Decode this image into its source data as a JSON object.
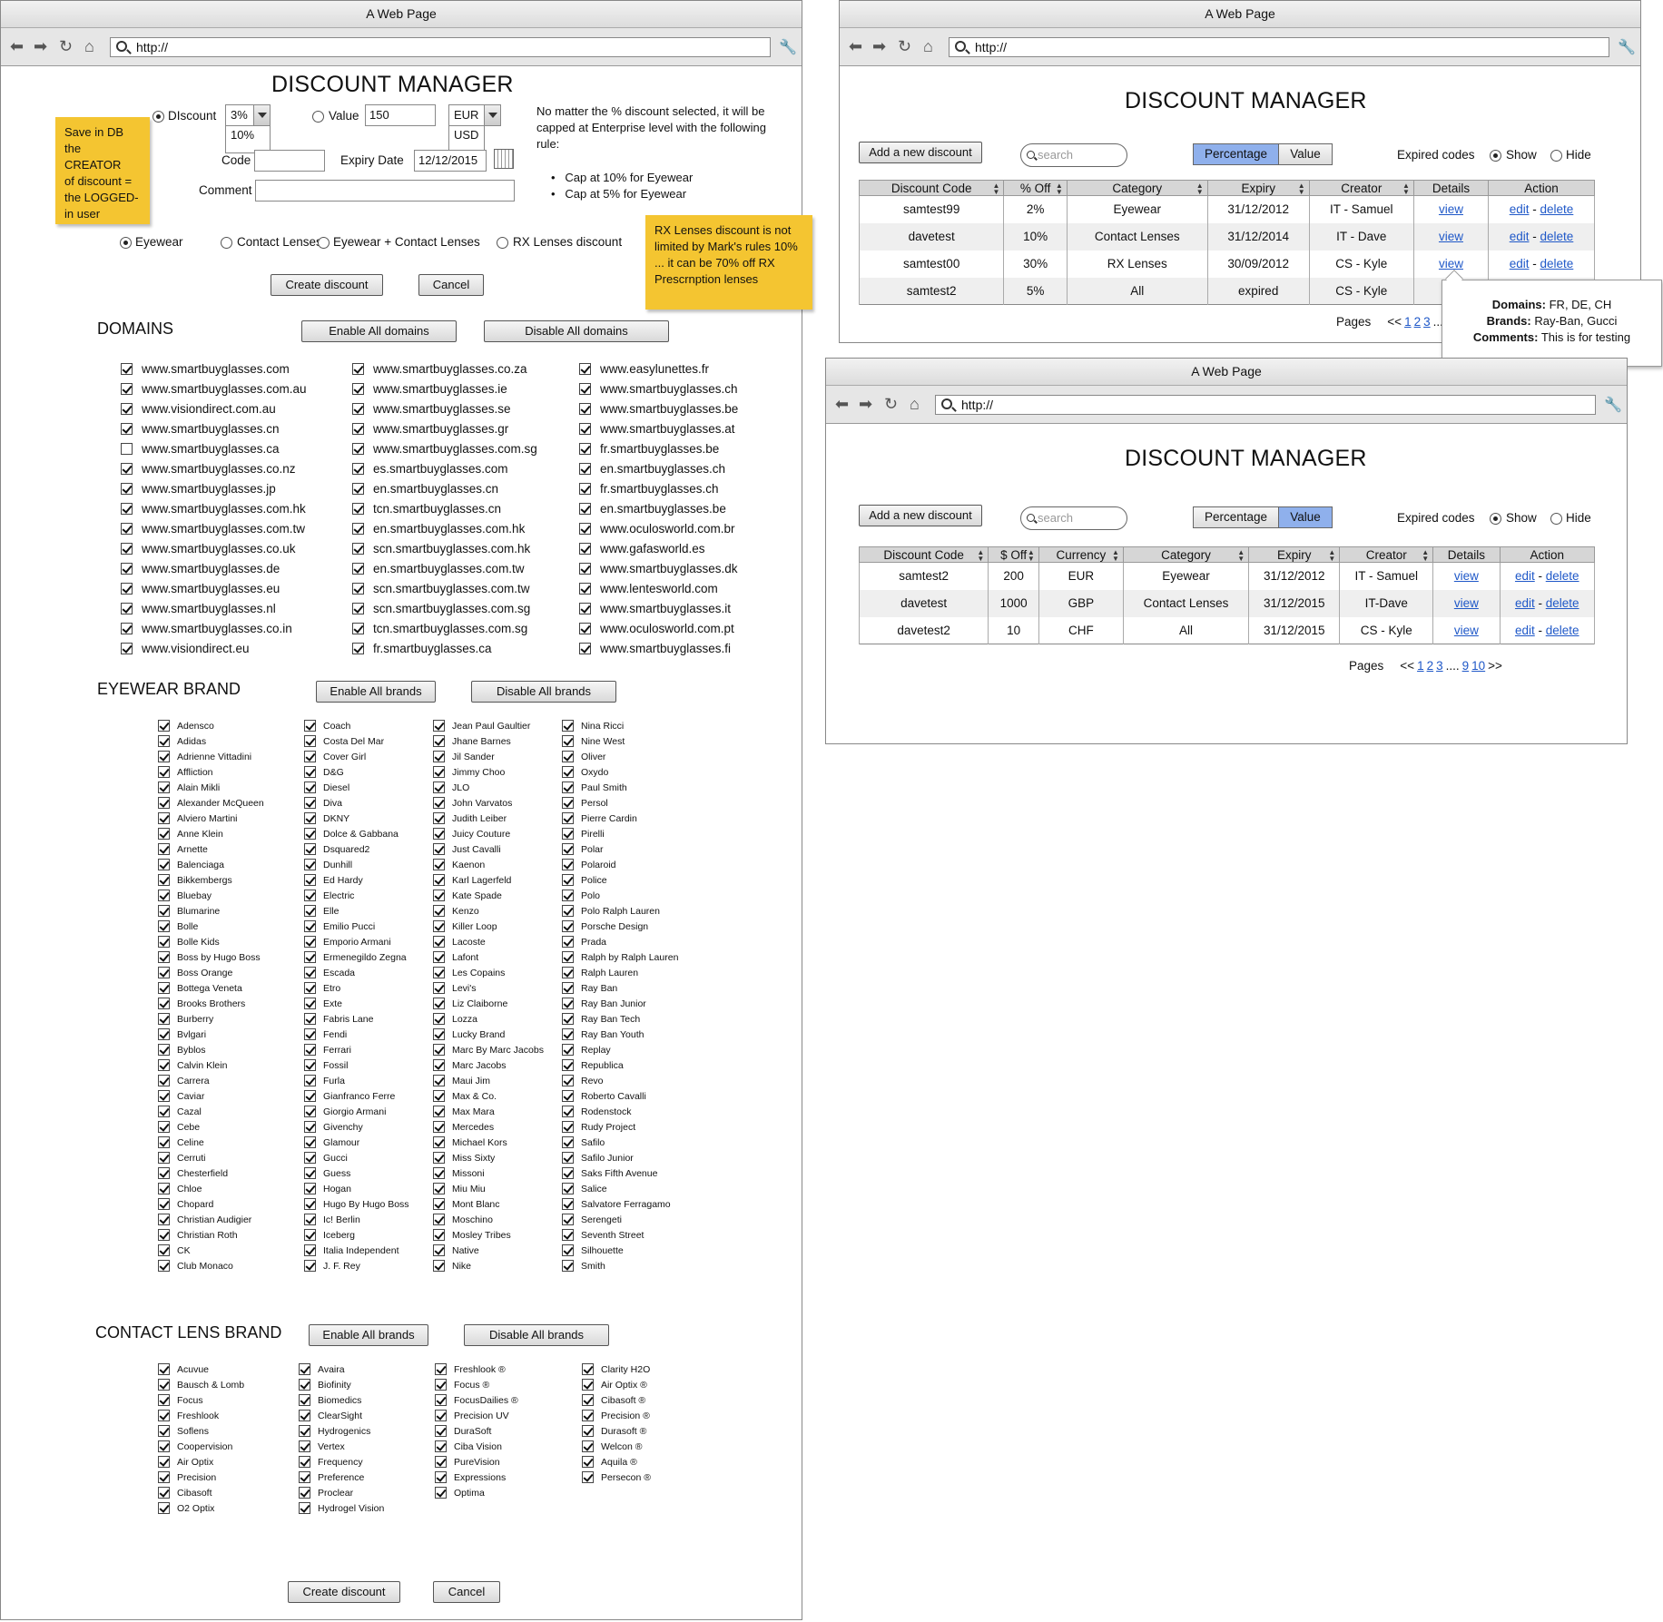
{
  "window_title": "A Web Page",
  "url": "http://",
  "app_title": "DISCOUNT MANAGER",
  "form": {
    "discount_label": "DIscount",
    "discount_selected": "3%",
    "discount_options": [
      "10%"
    ],
    "value_label": "Value",
    "value_input": "150",
    "currency_selected": "EUR",
    "currency_options": [
      "USD"
    ],
    "code_label": "Code",
    "code_value": "",
    "expiry_label": "Expiry Date",
    "expiry_value": "12/12/2015",
    "comment_label": "Comment",
    "comment_value": "",
    "note_line1": "No matter the % discount selected, it will be",
    "note_line2": "capped at Enterprise level with the following",
    "note_line3": "rule:",
    "rules": [
      "Cap at 10% for Eyewear",
      "Cap at 5% for Eyewear"
    ],
    "sticky_db": [
      "Save in DB",
      "the CREATOR",
      "of discount =",
      "the LOGGED-",
      "in user"
    ],
    "sticky_rx": [
      "RX Lenses discount is not",
      "limited by Mark's rules 10%",
      "... it can be 70% off RX",
      "Prescrnption lenses"
    ],
    "categories": [
      "Eyewear",
      "Contact Lenses",
      "Eyewear + Contact Lenses",
      "RX Lenses discount"
    ],
    "create_label": "Create discount",
    "cancel_label": "Cancel"
  },
  "domains": {
    "title": "DOMAINS",
    "enable_label": "Enable All domains",
    "disable_label": "Disable All domains",
    "columns": [
      [
        "www.smartbuyglasses.com",
        "www.smartbuyglasses.com.au",
        "www.visiondirect.com.au",
        "www.smartbuyglasses.cn",
        "www.smartbuyglasses.ca",
        "www.smartbuyglasses.co.nz",
        "www.smartbuyglasses.jp",
        "www.smartbuyglasses.com.hk",
        "www.smartbuyglasses.com.tw",
        "www.smartbuyglasses.co.uk",
        "www.smartbuyglasses.de",
        "www.smartbuyglasses.eu",
        "www.smartbuyglasses.nl",
        "www.smartbuyglasses.co.in",
        "www.visiondirect.eu"
      ],
      [
        "www.smartbuyglasses.co.za",
        "www.smartbuyglasses.ie",
        "www.smartbuyglasses.se",
        "www.smartbuyglasses.gr",
        "www.smartbuyglasses.com.sg",
        "es.smartbuyglasses.com",
        "en.smartbuyglasses.cn",
        "tcn.smartbuyglasses.cn",
        "en.smartbuyglasses.com.hk",
        "scn.smartbuyglasses.com.hk",
        "en.smartbuyglasses.com.tw",
        "scn.smartbuyglasses.com.tw",
        "scn.smartbuyglasses.com.sg",
        "tcn.smartbuyglasses.com.sg",
        "fr.smartbuyglasses.ca"
      ],
      [
        "www.easylunettes.fr",
        "www.smartbuyglasses.ch",
        "www.smartbuyglasses.be",
        "www.smartbuyglasses.at",
        "fr.smartbuyglasses.be",
        "en.smartbuyglasses.ch",
        "fr.smartbuyglasses.ch",
        "en.smartbuyglasses.be",
        "www.oculosworld.com.br",
        "www.gafasworld.es",
        "www.smartbuyglasses.dk",
        "www.lentesworld.com",
        "www.smartbuyglasses.it",
        "www.oculosworld.com.pt",
        "www.smartbuyglasses.fi"
      ]
    ],
    "unchecked": [
      "www.smartbuyglasses.ca"
    ]
  },
  "eyewear": {
    "title": "EYEWEAR BRAND",
    "enable_label": "Enable All brands",
    "disable_label": "Disable All brands",
    "columns": [
      [
        "Adensco",
        "Adidas",
        "Adrienne Vittadini",
        "Affliction",
        "Alain Mikli",
        "Alexander McQueen",
        "Alviero Martini",
        "Anne Klein",
        "Arnette",
        "Balenciaga",
        "Bikkembergs",
        "Bluebay",
        "Blumarine",
        "Bolle",
        "Bolle Kids",
        "Boss by Hugo Boss",
        "Boss Orange",
        "Bottega Veneta",
        "Brooks Brothers",
        "Burberry",
        "Bvlgari",
        "Byblos",
        "Calvin Klein",
        "Carrera",
        "Caviar",
        "Cazal",
        "Cebe",
        "Celine",
        "Cerruti",
        "Chesterfield",
        "Chloe",
        "Chopard",
        "Christian Audigier",
        "Christian Roth",
        "CK",
        "Club Monaco"
      ],
      [
        "Coach",
        "Costa Del Mar",
        "Cover Girl",
        "D&G",
        "Diesel",
        "Diva",
        "DKNY",
        "Dolce & Gabbana",
        "Dsquared2",
        "Dunhill",
        "Ed Hardy",
        "Electric",
        "Elle",
        "Emilio Pucci",
        "Emporio Armani",
        "Ermenegildo Zegna",
        "Escada",
        "Etro",
        "Exte",
        "Fabris Lane",
        "Fendi",
        "Ferrari",
        "Fossil",
        "Furla",
        "Gianfranco Ferre",
        "Giorgio Armani",
        "Givenchy",
        "Glamour",
        "Gucci",
        "Guess",
        "Hogan",
        "Hugo By Hugo Boss",
        "Ic! Berlin",
        "Iceberg",
        "Italia Independent",
        "J. F. Rey"
      ],
      [
        "Jean Paul Gaultier",
        "Jhane Barnes",
        "Jil Sander",
        "Jimmy Choo",
        "JLO",
        "John Varvatos",
        "Judith Leiber",
        "Juicy Couture",
        "Just Cavalli",
        "Kaenon",
        "Karl Lagerfeld",
        "Kate Spade",
        "Kenzo",
        "Killer Loop",
        "Lacoste",
        "Lafont",
        "Les Copains",
        "Levi's",
        "Liz Claiborne",
        "Lozza",
        "Lucky Brand",
        "Marc By Marc Jacobs",
        "Marc Jacobs",
        "Maui Jim",
        "Max & Co.",
        "Max Mara",
        "Mercedes",
        "Michael Kors",
        "Miss Sixty",
        "Missoni",
        "Miu Miu",
        "Mont Blanc",
        "Moschino",
        "Mosley Tribes",
        "Native",
        "Nike"
      ],
      [
        "Nina Ricci",
        "Nine West",
        "Oliver",
        "Oxydo",
        "Paul Smith",
        "Persol",
        "Pierre Cardin",
        "Pirelli",
        "Polar",
        "Polaroid",
        "Police",
        "Polo",
        "Polo Ralph Lauren",
        "Porsche Design",
        "Prada",
        "Ralph by Ralph Lauren",
        "Ralph Lauren",
        "Ray Ban",
        "Ray Ban Junior",
        "Ray Ban Tech",
        "Ray Ban Youth",
        "Replay",
        "Republica",
        "Revo",
        "Roberto Cavalli",
        "Rodenstock",
        "Rudy Project",
        "Safilo",
        "Safilo Junior",
        "Saks Fifth Avenue",
        "Salice",
        "Salvatore Ferragamo",
        "Serengeti",
        "Seventh Street",
        "Silhouette",
        "Smith"
      ]
    ]
  },
  "contact": {
    "title": "CONTACT LENS BRAND",
    "enable_label": "Enable All brands",
    "disable_label": "Disable All brands",
    "columns": [
      [
        "Acuvue",
        "Bausch & Lomb",
        "Focus",
        "Freshlook",
        "Soflens",
        "Coopervision",
        "Air Optix",
        "Precision",
        "Cibasoft",
        "O2 Optix"
      ],
      [
        "Avaira",
        "Biofinity",
        "Biomedics",
        "ClearSight",
        "Hydrogenics",
        "Vertex",
        "Frequency",
        "Preference",
        "Proclear",
        "Hydrogel Vision"
      ],
      [
        "Freshlook ®",
        "Focus ®",
        "FocusDailies ®",
        "Precision UV",
        "DuraSoft",
        "Ciba Vision",
        "PureVision",
        "Expressions",
        "Optima"
      ],
      [
        "Clarity H2O",
        "Air Optix ®",
        "Cibasoft ®",
        "Precision ®",
        "Durasoft ®",
        "Welcon ®",
        "Aquila ®",
        "Persecon ®"
      ]
    ]
  },
  "list": {
    "add_label": "Add a new discount",
    "search_placeholder": "search",
    "seg_percentage": "Percentage",
    "seg_value": "Value",
    "expired_label": "Expired codes",
    "show_label": "Show",
    "hide_label": "Hide",
    "pages_label": "Pages",
    "view_label": "view",
    "edit_label": "edit",
    "sep": " - ",
    "delete_label": "delete"
  },
  "pct_table": {
    "headers": [
      "Discount Code",
      "% Off",
      "Category",
      "Expiry",
      "Creator",
      "Details",
      "Action"
    ],
    "rows": [
      [
        "samtest99",
        "2%",
        "Eyewear",
        "31/12/2012",
        "IT - Samuel"
      ],
      [
        "davetest",
        "10%",
        "Contact Lenses",
        "31/12/2014",
        "IT - Dave"
      ],
      [
        "samtest00",
        "30%",
        "RX Lenses",
        "30/09/2012",
        "CS - Kyle"
      ],
      [
        "samtest2",
        "5%",
        "All",
        "expired",
        "CS - Kyle"
      ]
    ],
    "pagination": [
      "<<",
      "1",
      "2",
      "3",
      "...."
    ]
  },
  "tooltip": {
    "domains_label": "Domains:",
    "domains_value": " FR, DE, CH",
    "brands_label": "Brands:",
    "brands_value": " Ray-Ban, Gucci",
    "comments_label": "Comments:",
    "comments_value": " This is for testing"
  },
  "val_table": {
    "headers": [
      "Discount Code",
      "$ Off",
      "Currency",
      "Category",
      "Expiry",
      "Creator",
      "Details",
      "Action"
    ],
    "rows": [
      [
        "samtest2",
        "200",
        "EUR",
        "Eyewear",
        "31/12/2012",
        "IT - Samuel"
      ],
      [
        "davetest",
        "1000",
        "GBP",
        "Contact Lenses",
        "31/12/2015",
        "IT-Dave"
      ],
      [
        "davetest2",
        "10",
        "CHF",
        "All",
        "31/12/2015",
        "CS - Kyle"
      ]
    ],
    "pagination": [
      "<<",
      "1",
      "2",
      "3",
      "....",
      "9",
      "10",
      ">>"
    ]
  }
}
